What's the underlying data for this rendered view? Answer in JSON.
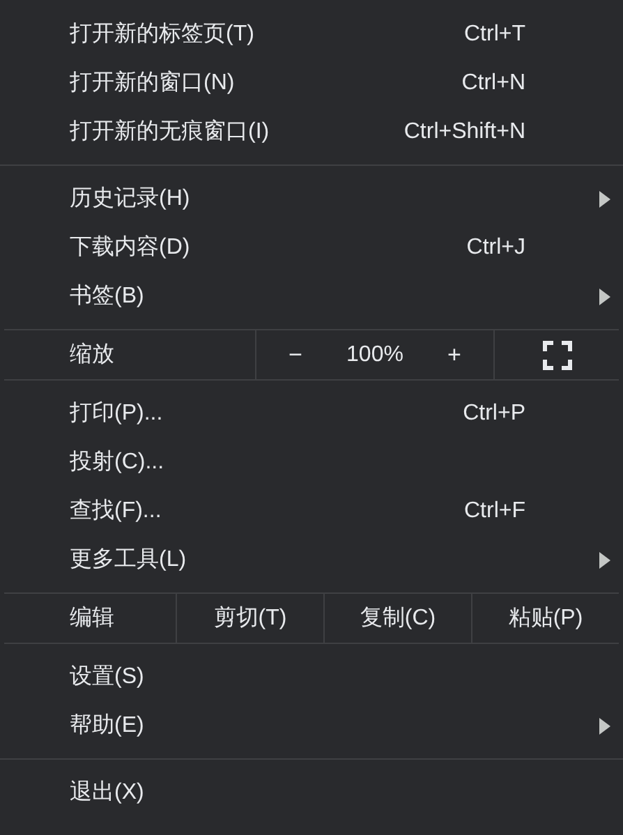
{
  "sections": [
    {
      "items": [
        {
          "kind": "item",
          "label": "打开新的标签页(T)",
          "shortcut": "Ctrl+T",
          "submenu": false
        },
        {
          "kind": "item",
          "label": "打开新的窗口(N)",
          "shortcut": "Ctrl+N",
          "submenu": false
        },
        {
          "kind": "item",
          "label": "打开新的无痕窗口(I)",
          "shortcut": "Ctrl+Shift+N",
          "submenu": false
        }
      ]
    },
    {
      "items": [
        {
          "kind": "item",
          "label": "历史记录(H)",
          "submenu": true
        },
        {
          "kind": "item",
          "label": "下载内容(D)",
          "shortcut": "Ctrl+J",
          "submenu": false
        },
        {
          "kind": "item",
          "label": "书签(B)",
          "submenu": true
        }
      ]
    },
    {
      "items": [
        {
          "kind": "zoom",
          "label": "缩放",
          "minus": "−",
          "value": "100%",
          "plus": "+"
        }
      ]
    },
    {
      "items": [
        {
          "kind": "item",
          "label": "打印(P)...",
          "shortcut": "Ctrl+P",
          "submenu": false
        },
        {
          "kind": "item",
          "label": "投射(C)...",
          "submenu": false
        },
        {
          "kind": "item",
          "label": "查找(F)...",
          "shortcut": "Ctrl+F",
          "submenu": false
        },
        {
          "kind": "item",
          "label": "更多工具(L)",
          "submenu": true
        }
      ]
    },
    {
      "items": [
        {
          "kind": "edit",
          "label": "编辑",
          "actions": [
            "剪切(T)",
            "复制(C)",
            "粘贴(P)"
          ]
        }
      ]
    },
    {
      "items": [
        {
          "kind": "item",
          "label": "设置(S)",
          "submenu": false
        },
        {
          "kind": "item",
          "label": "帮助(E)",
          "submenu": true
        }
      ]
    },
    {
      "items": [
        {
          "kind": "item",
          "label": "退出(X)",
          "submenu": false
        }
      ]
    }
  ]
}
